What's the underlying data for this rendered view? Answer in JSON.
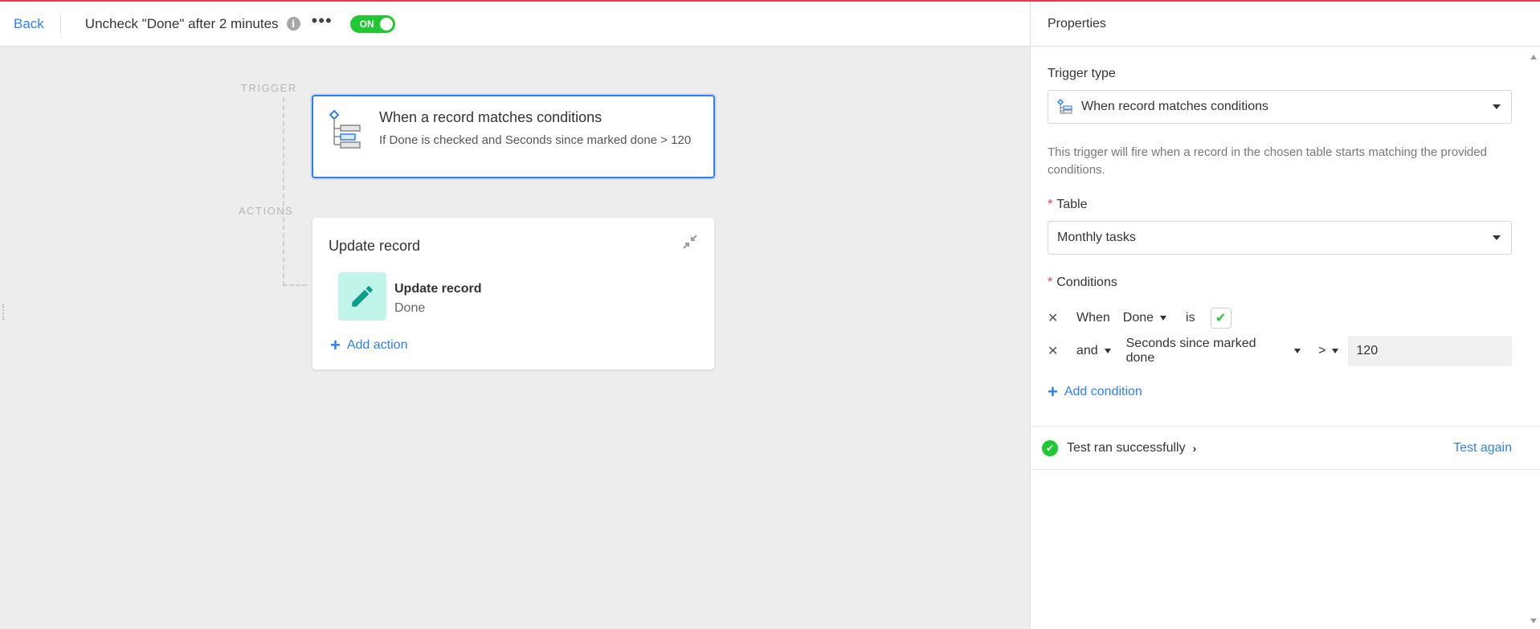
{
  "header": {
    "back_label": "Back",
    "automation_title": "Uncheck \"Done\" after 2 minutes",
    "toggle_label": "ON"
  },
  "flow": {
    "trigger_label": "TRIGGER",
    "actions_label": "ACTIONS",
    "trigger": {
      "title": "When a record matches conditions",
      "subtitle": "If Done is checked and Seconds since marked done > 120"
    },
    "action_group": {
      "title": "Update record",
      "step_title": "Update record",
      "step_sub": "Done",
      "add_action_label": "Add action"
    }
  },
  "panel": {
    "title": "Properties",
    "trigger_type_label": "Trigger type",
    "trigger_type_value": "When record matches conditions",
    "description": "This trigger will fire when a record in the chosen table starts matching the provided conditions.",
    "table_label": "Table",
    "table_value": "Monthly tasks",
    "conditions_label": "Conditions",
    "conditions": [
      {
        "conjunction": "When",
        "field": "Done",
        "operator": "is"
      },
      {
        "conjunction": "and",
        "field": "Seconds since marked done",
        "operator": ">",
        "value": "120"
      }
    ],
    "add_condition_label": "Add condition",
    "test_status": "Test ran successfully",
    "test_again_label": "Test again"
  },
  "colors": {
    "accent_blue": "#2d7ff9",
    "success_green": "#20c933",
    "top_bar_red": "#e8384f",
    "action_icon_bg": "#c2f5e9"
  }
}
